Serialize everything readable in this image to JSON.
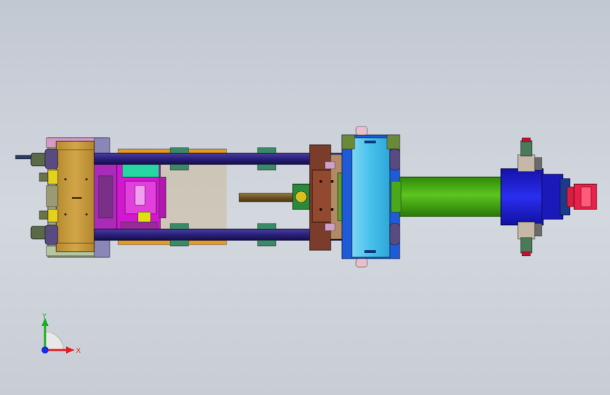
{
  "viewport": {
    "background_top": "#c2c8d2",
    "background_bottom": "#c8cdd5"
  },
  "triad": {
    "x_label": "X",
    "y_label": "Y",
    "x_color": "#e02020",
    "y_color": "#18b020",
    "z_color": "#1a2ee0"
  },
  "model_colors": {
    "tie_bar": "#2a1f7a",
    "rear_platen": "#c79a3a",
    "moving_platen": "#3bb7e6",
    "cylinder": "#3fa10f",
    "cylinder_head": "#1f20d8",
    "nozzle": "#e8204a",
    "mold_magenta": "#d316cf",
    "mold_green": "#27d6a2",
    "brown_block": "#7b3c2b",
    "base_frame": "#4b5a2a"
  }
}
